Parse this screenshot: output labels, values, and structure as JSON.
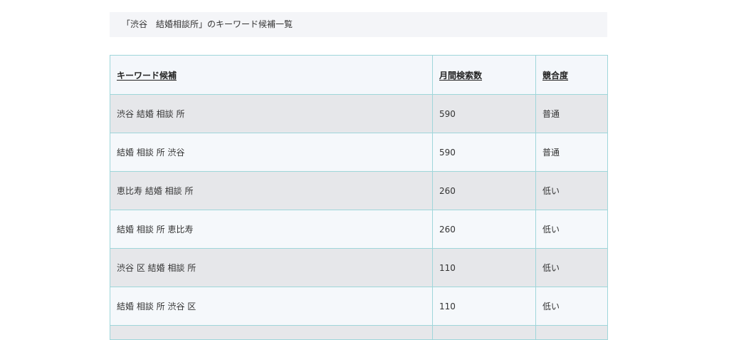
{
  "caption": {
    "text": "「渋谷　結婚相談所」のキーワード候補一覧"
  },
  "table": {
    "headers": [
      "キーワード候補",
      "月間検索数",
      "競合度"
    ],
    "rows": [
      [
        "渋谷 結婚 相談 所",
        "590",
        "普通"
      ],
      [
        "結婚 相談 所 渋谷",
        "590",
        "普通"
      ],
      [
        "恵比寿 結婚 相談 所",
        "260",
        "低い"
      ],
      [
        "結婚 相談 所 恵比寿",
        "260",
        "低い"
      ],
      [
        "渋谷 区 結婚 相談 所",
        "110",
        "低い"
      ],
      [
        "結婚 相談 所 渋谷 区",
        "110",
        "低い"
      ]
    ]
  },
  "colors": {
    "caption_bg": "#f4f5f8",
    "header_bg": "#f4f7fb",
    "row_odd_bg": "#e6e7ea",
    "row_even_bg": "#f5f8fb",
    "border": "#9fd6da"
  }
}
